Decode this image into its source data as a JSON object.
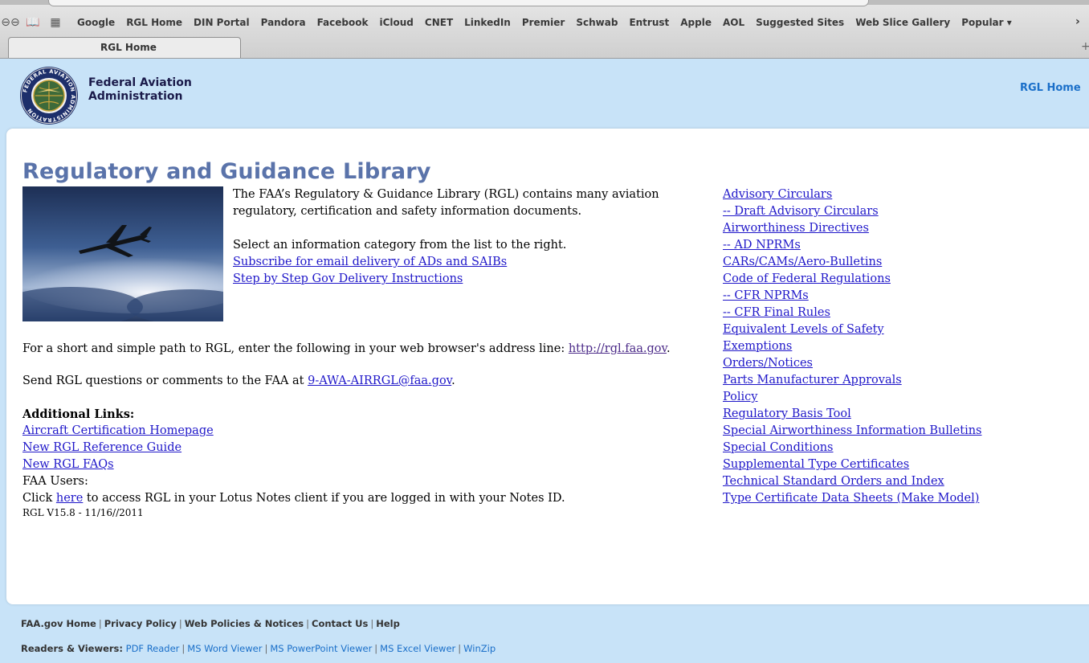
{
  "browser": {
    "bookmarks": [
      "Google",
      "RGL Home",
      "DIN Portal",
      "Pandora",
      "Facebook",
      "iCloud",
      "CNET",
      "LinkedIn",
      "Premier",
      "Schwab",
      "Entrust",
      "Apple",
      "AOL",
      "Suggested Sites",
      "Web Slice Gallery",
      "Popular ▾"
    ],
    "active_tab": "RGL Home"
  },
  "header": {
    "agency_line1": "Federal Aviation",
    "agency_line2": "Administration",
    "home_link": "RGL Home",
    "seal_text": "FEDERAL AVIATION ADMINISTRATION"
  },
  "main": {
    "title": "Regulatory and Guidance Library",
    "intro": "The FAA’s Regulatory & Guidance Library (RGL) contains many aviation regulatory, certification and safety information documents.",
    "select_text": "Select an information category from the list to the right.",
    "subscribe_link": "Subscribe for email delivery of ADs and SAIBs",
    "instructions_link": "Step by Step Gov Delivery Instructions",
    "short_path_text": "For a short and simple path to RGL, enter the following in your web browser's address line: ",
    "short_path_url": "http://rgl.faa.gov",
    "send_text": "Send RGL questions or comments to the FAA at ",
    "email": "9-AWA-AIRRGL@faa.gov",
    "additional_heading": "Additional Links:",
    "additional_links": [
      "Aircraft Certification Homepage",
      "New RGL Reference Guide",
      "New RGL FAQs"
    ],
    "faa_users": "FAA Users:",
    "click_prefix": "Click ",
    "here_link": "here",
    "click_suffix": " to access RGL in your Lotus Notes client if you are logged in with your Notes ID.",
    "version": "RGL V15.8 - 11/16//2011"
  },
  "categories": [
    "Advisory Circulars",
    "-- Draft Advisory Circulars",
    "Airworthiness Directives",
    "-- AD NPRMs",
    "CARs/CAMs/Aero-Bulletins",
    "Code of Federal Regulations",
    "-- CFR NPRMs",
    "-- CFR Final Rules",
    "Equivalent Levels of Safety",
    "Exemptions",
    "Orders/Notices",
    "Parts Manufacturer Approvals",
    "Policy",
    "Regulatory Basis Tool",
    "Special Airworthiness Information Bulletins",
    "Special Conditions",
    "Supplemental Type Certificates",
    "Technical Standard Orders and Index",
    "Type Certificate Data Sheets (Make Model)"
  ],
  "footer": {
    "links": [
      "FAA.gov Home",
      "Privacy Policy",
      "Web Policies & Notices",
      "Contact Us",
      "Help"
    ],
    "readers_label": "Readers & Viewers:",
    "readers": [
      "PDF Reader",
      "MS Word Viewer",
      "MS PowerPoint Viewer",
      "MS Excel Viewer",
      "WinZip"
    ]
  },
  "colors": {
    "header_bg": "#c8e3f8",
    "title": "#5a73aa",
    "link": "#1f17c9",
    "footer_link": "#1a6fc9"
  }
}
